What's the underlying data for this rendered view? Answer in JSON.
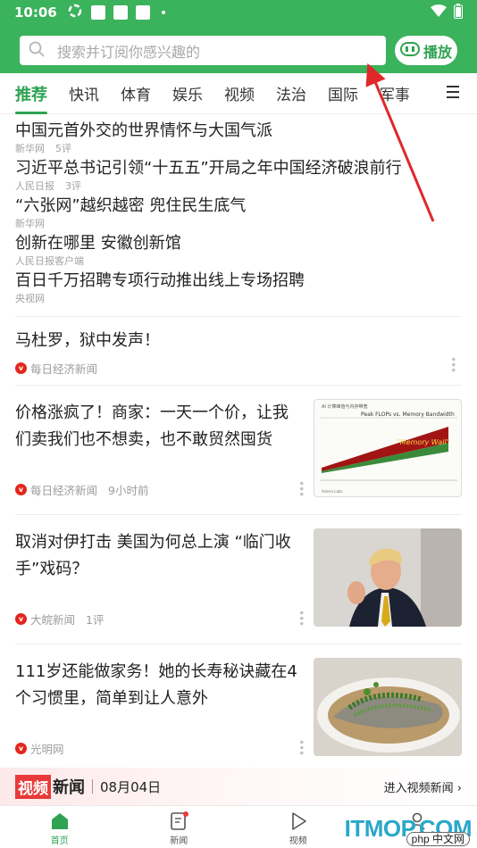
{
  "status": {
    "time": "10:06"
  },
  "search": {
    "placeholder": "搜索并订阅你感兴趣的",
    "play_label": "播放"
  },
  "tabs": [
    {
      "label": "推荐",
      "active": true
    },
    {
      "label": "快讯"
    },
    {
      "label": "体育"
    },
    {
      "label": "娱乐"
    },
    {
      "label": "视频"
    },
    {
      "label": "法治"
    },
    {
      "label": "国际"
    },
    {
      "label": "军事"
    }
  ],
  "headlines": [
    {
      "title": "中国元首外交的世界情怀与大国气派",
      "source": "新华网",
      "comments": "5评"
    },
    {
      "title": "习近平总书记引领“十五五”开局之年中国经济破浪前行",
      "source": "人民日报",
      "comments": "3评"
    },
    {
      "title": "“六张网”越织越密 兜住民生底气",
      "source": "新华网",
      "comments": ""
    },
    {
      "title": "创新在哪里 安徽创新馆",
      "source": "人民日报客户端",
      "comments": ""
    },
    {
      "title": "百日千万招聘专项行动推出线上专场招聘",
      "source": "央视网",
      "comments": ""
    }
  ],
  "feed": {
    "item1": {
      "title": "马杜罗，狱中发声！",
      "source": "每日经济新闻"
    },
    "item2": {
      "title": "价格涨疯了！商家：一天一个价，让我们卖我们也不想卖，也不敢贸然囤货",
      "source": "每日经济新闻",
      "time": "9小时前",
      "thumb": {
        "title": "Peak FLOPs vs. Memory Bandwidth",
        "label": "\"Memory Wall\""
      }
    },
    "item3": {
      "title": "取消对伊打击 美国为何总上演 “临门收手”戏码？",
      "source": "大皖新闻",
      "comments": "1评"
    },
    "item4": {
      "title": "111岁还能做家务！她的长寿秘诀藏在4个习惯里，简单到让人意外",
      "source": "光明网"
    }
  },
  "banner": {
    "tag1": "视频",
    "tag2": "新闻",
    "date": "08月04日",
    "link": "进入视频新闻 ›"
  },
  "bottom_nav": [
    {
      "label": "首页",
      "active": true
    },
    {
      "label": "新闻"
    },
    {
      "label": "视频"
    },
    {
      "label": "我的"
    }
  ],
  "watermark": {
    "main": "ITMOP.COM",
    "sub": "php 中文网"
  },
  "colors": {
    "brand_green": "#3bb25c",
    "accent_red": "#e3251c"
  }
}
